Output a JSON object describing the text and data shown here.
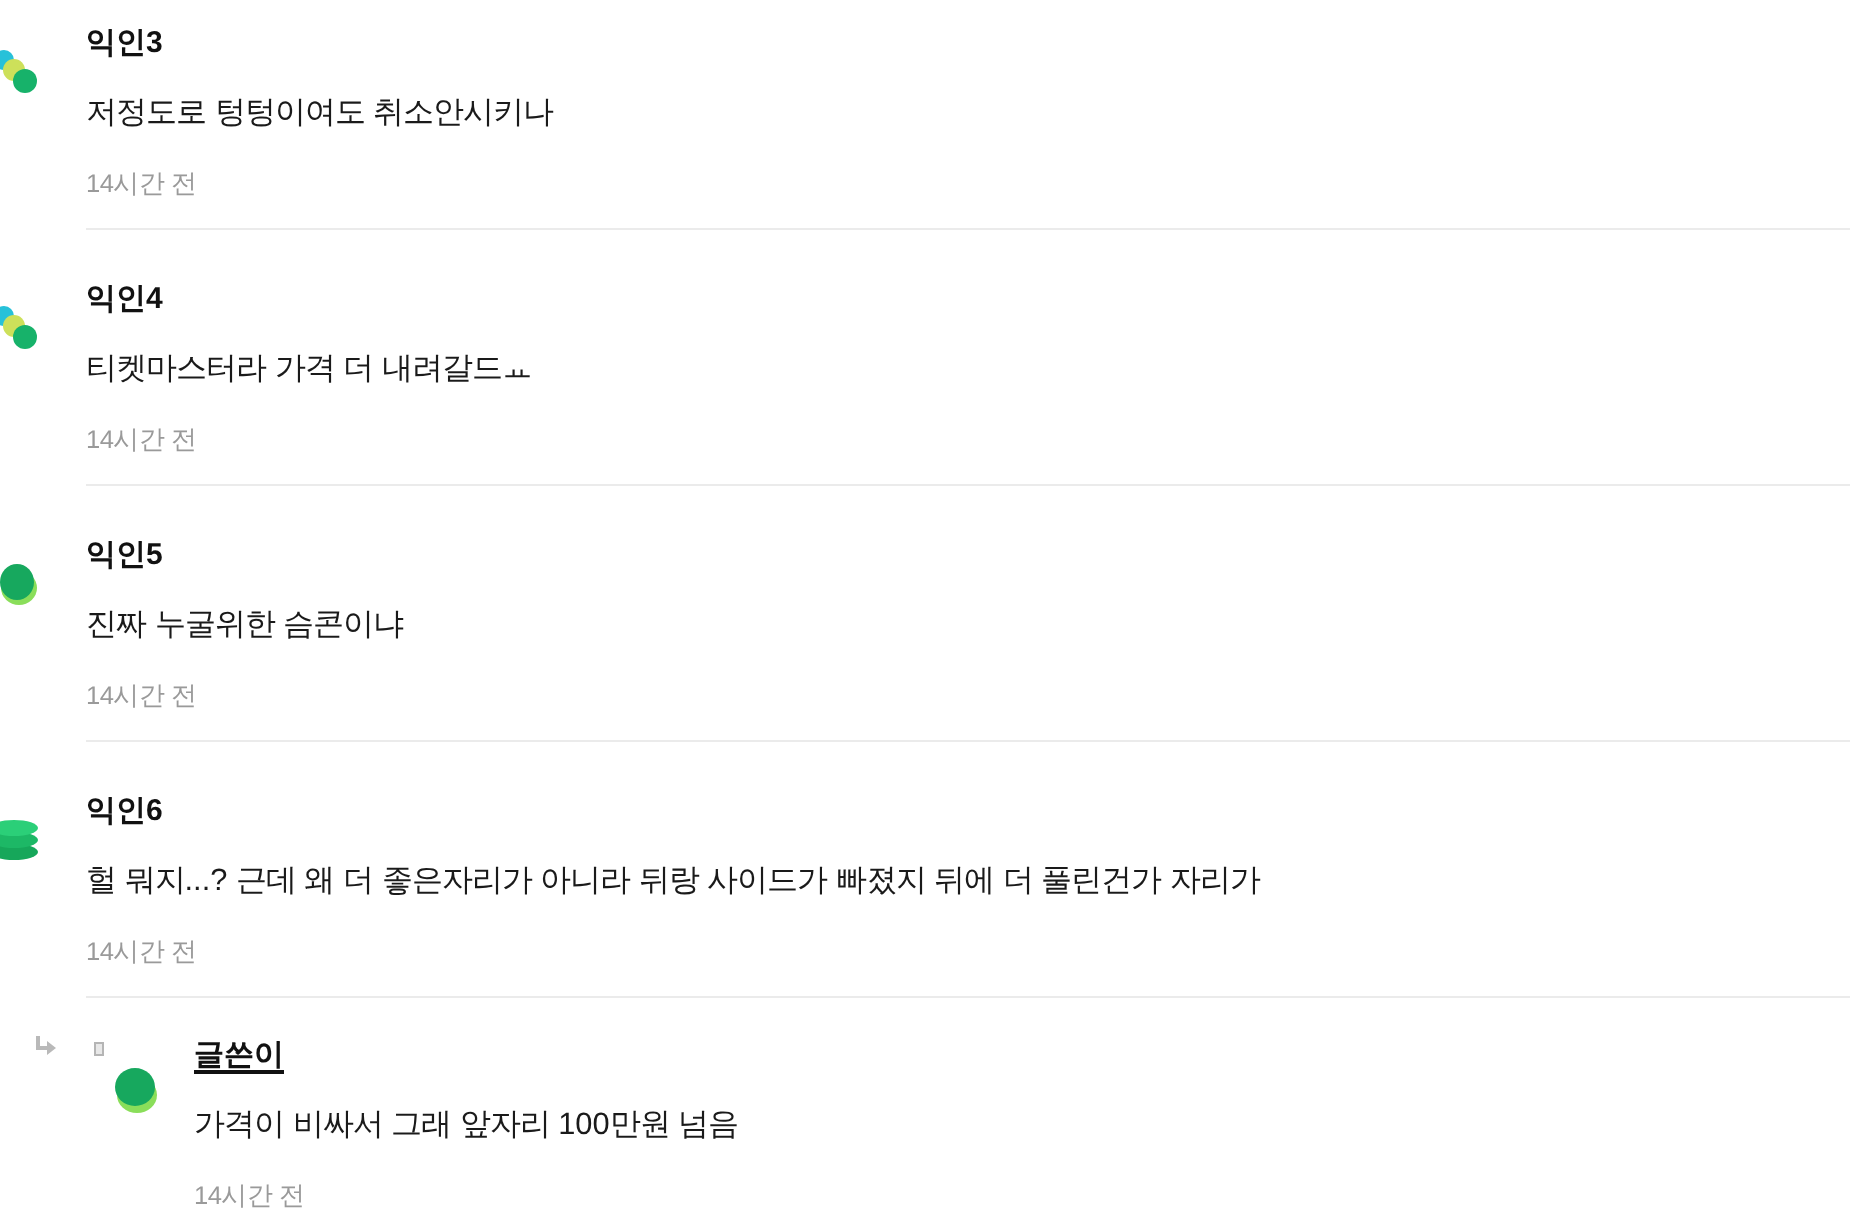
{
  "comments": [
    {
      "kind": "comment",
      "avatar": {
        "kind": "dots"
      },
      "author": "익인3",
      "op": false,
      "body": "저정도로 텅텅이여도 취소안시키나",
      "time": "14시간 전"
    },
    {
      "kind": "comment",
      "avatar": {
        "kind": "dots"
      },
      "author": "익인4",
      "op": false,
      "body": "티켓마스터라 가격 더 내려갈드ㅛ",
      "time": "14시간 전"
    },
    {
      "kind": "comment",
      "avatar": {
        "kind": "blob"
      },
      "author": "익인5",
      "op": false,
      "body": "진짜 누굴위한 슴콘이냐",
      "time": "14시간 전"
    },
    {
      "kind": "comment",
      "avatar": {
        "kind": "stack"
      },
      "author": "익인6",
      "op": false,
      "body": "헐 뭐지...? 근데 왜 더 좋은자리가 아니라 뒤랑 사이드가 빠졌지 뒤에 더 풀린건가 자리가",
      "time": "14시간 전"
    },
    {
      "kind": "reply",
      "avatar": {
        "kind": "blob"
      },
      "author": "글쓴이",
      "op": true,
      "body": "가격이 비싸서 그래 앞자리 100만원 넘음",
      "time": "14시간 전"
    }
  ]
}
